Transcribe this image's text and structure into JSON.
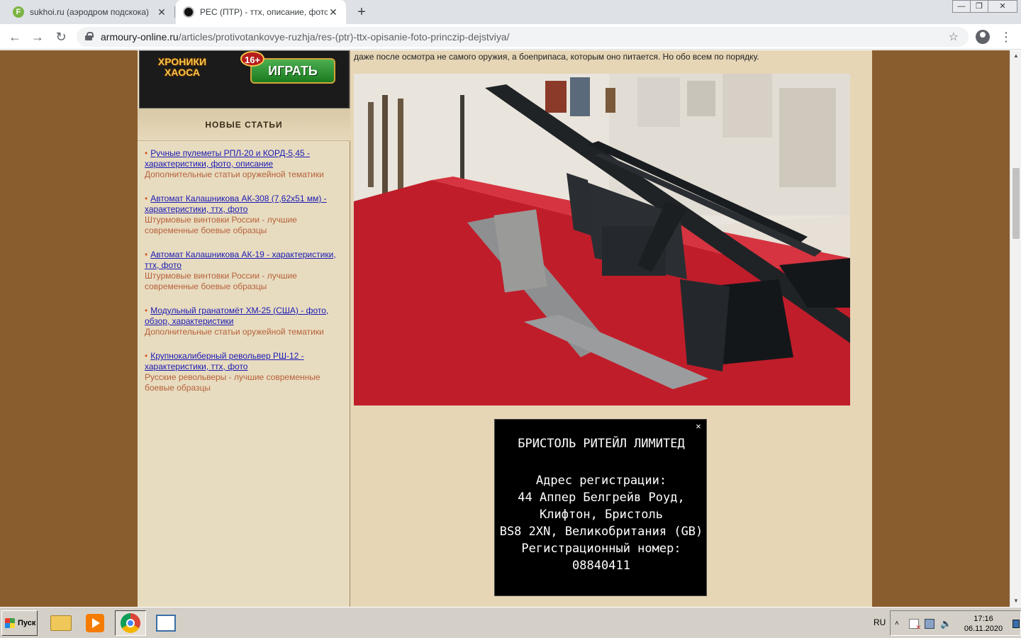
{
  "browser": {
    "tabs": [
      {
        "title": "sukhoi.ru (аэродром подскока)",
        "favicon_letter": "F",
        "active": false
      },
      {
        "title": "РЕС (ПТР) - ттх, описание, фото, п",
        "active": true
      }
    ],
    "new_tab_label": "+",
    "window_controls": {
      "minimize": "—",
      "maximize": "❐",
      "close": "✕"
    },
    "nav": {
      "back": "←",
      "forward": "→",
      "reload": "↻"
    },
    "url_host": "armoury-online.ru",
    "url_path": "/articles/protivotankovye-ruzhja/res-(ptr)-ttx-opisanie-foto-princzip-dejstviya/",
    "bookmark_icon": "☆",
    "menu_icon": "⋮"
  },
  "sidebar": {
    "banner": {
      "logo": "ХРОНИКИ ХАОСА",
      "age": "16+",
      "play": "ИГРАТЬ"
    },
    "heading": "НОВЫЕ СТАТЬИ",
    "articles": [
      {
        "title": "Ручные пулеметы РПЛ-20 и КОРД-5,45 - характеристики, фото, описание",
        "category": "Дополнительные статьи оружейной тематики"
      },
      {
        "title": "Автомат Калашникова АК-308 (7,62х51 мм) - характеристики, ттх, фото",
        "category": "Штурмовые винтовки России - лучшие современные боевые образцы"
      },
      {
        "title": "Автомат Калашникова АК-19 - характеристики, ттх, фото",
        "category": "Штурмовые винтовки России - лучшие современные боевые образцы"
      },
      {
        "title": "Модульный гранатомёт XM-25 (США) - фото, обзор, характеристики",
        "category": "Дополнительные статьи оружейной тематики"
      },
      {
        "title": "Крупнокалиберный револьвер РШ-12 - характеристики, ттх, фото",
        "category": "Русские револьверы - лучшие современные боевые образцы"
      }
    ]
  },
  "main": {
    "intro": "даже после осмотра не самого оружия, а боеприпаса, которым оно питается. Но обо всем по порядку."
  },
  "ad": {
    "close": "✕",
    "company": "БРИСТОЛЬ РИТЕЙЛ ЛИМИТЕД",
    "lines": [
      "Адрес регистрации:",
      "44 Аппер Белгрейв Роуд,",
      "Клифтон, Бристоль",
      "BS8 2XN, Великобритания (GB)",
      "Регистрационный номер:",
      "08840411"
    ]
  },
  "taskbar": {
    "start": "Пуск",
    "lang": "RU",
    "tray_chevron": "˄",
    "volume_icon": "🔈",
    "time": "17:16",
    "date": "06.11.2020"
  }
}
